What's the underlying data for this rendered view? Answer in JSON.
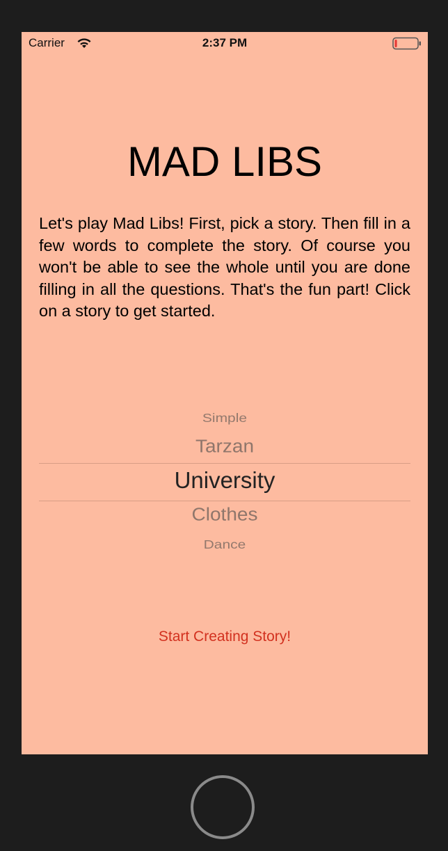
{
  "status_bar": {
    "carrier": "Carrier",
    "time": "2:37 PM",
    "icons": [
      "wifi-icon",
      "battery-icon"
    ],
    "battery_level": 0.1,
    "battery_color": "#e53935"
  },
  "main": {
    "title": "MAD LIBS",
    "intro": "Let's play Mad Libs! First, pick a story. Then fill in a few words to complete the story. Of course you won't be able to see the whole until you are done filling in all the questions. That's the fun part! Click on a story to get started.",
    "picker": {
      "items": [
        "Simple",
        "Tarzan",
        "University",
        "Clothes",
        "Dance"
      ],
      "selected": "University"
    },
    "start_button": "Start Creating Story!"
  },
  "colors": {
    "background": "#fdbba0",
    "accent": "#d2311f",
    "device_frame": "#1d1d1d"
  }
}
